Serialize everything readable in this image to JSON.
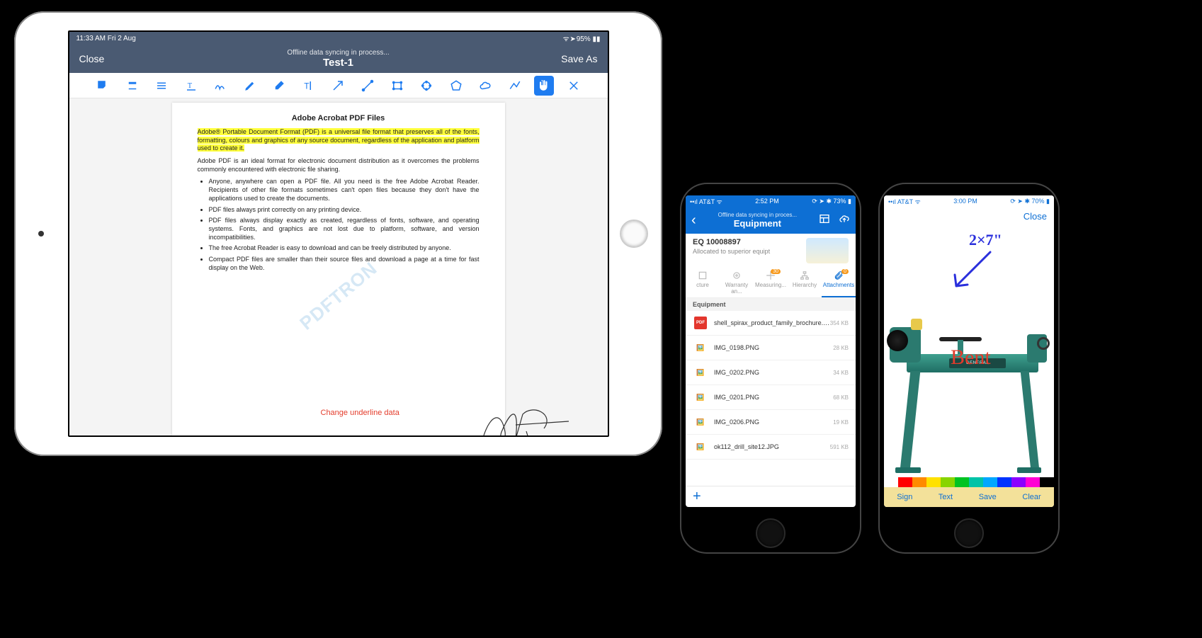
{
  "ipad": {
    "status_left": "11:33 AM  Fri 2 Aug",
    "status_right": "95%",
    "close_label": "Close",
    "saveas_label": "Save As",
    "sync_text": "Offline data syncing in process...",
    "doc_title": "Test-1",
    "toolbar_selected_index": 15,
    "page": {
      "heading": "Adobe Acrobat PDF Files",
      "highlight_para": "Adobe® Portable Document Format (PDF) is a universal file format that preserves all of the fonts, formatting, colours and graphics of any source document, regardless of the application and platform used to create it.",
      "intro_para": "Adobe PDF is an ideal format for electronic document distribution as it overcomes the problems commonly encountered with electronic file sharing.",
      "bullets": [
        "Anyone, anywhere can open a PDF file. All you need is the free Adobe Acrobat Reader. Recipients of other file formats sometimes can't open files because they don't have the applications used to create the documents.",
        "PDF files always print correctly on any printing device.",
        "PDF files always display exactly as created, regardless of fonts, software, and operating systems. Fonts, and graphics are not lost due to platform, software, and version incompatibilities.",
        "The free Acrobat Reader is easy to download and can be freely distributed by anyone.",
        "Compact PDF files are smaller than their source files and download a page at a time for fast display on the Web."
      ],
      "watermark": "PDFTRON",
      "red_annotation": "Change underline data"
    }
  },
  "iphone1": {
    "carrier": "AT&T",
    "time": "2:52 PM",
    "batt": "73%",
    "sync_text": "Offline data syncing in proces...",
    "screen_title": "Equipment",
    "eq": {
      "id": "EQ 10008897",
      "alloc": "Allocated to superior equipt"
    },
    "tabs": [
      {
        "label": "cture",
        "badge": ""
      },
      {
        "label": "Warranty an...",
        "badge": ""
      },
      {
        "label": "Measuring...",
        "badge": "30"
      },
      {
        "label": "Hierarchy",
        "badge": ""
      },
      {
        "label": "Attachments",
        "badge": "0",
        "selected": true
      }
    ],
    "section_label": "Equipment",
    "files": [
      {
        "type": "pdf",
        "name": "shell_spirax_product_family_brochure.PDF",
        "size": "354 KB"
      },
      {
        "type": "img",
        "name": "IMG_0198.PNG",
        "size": "28 KB"
      },
      {
        "type": "img",
        "name": "IMG_0202.PNG",
        "size": "34 KB"
      },
      {
        "type": "img",
        "name": "IMG_0201.PNG",
        "size": "68 KB"
      },
      {
        "type": "img",
        "name": "IMG_0206.PNG",
        "size": "19 KB"
      },
      {
        "type": "img",
        "name": "ok112_drill_site12.JPG",
        "size": "591 KB"
      }
    ]
  },
  "iphone2": {
    "carrier": "AT&T",
    "time": "3:00 PM",
    "batt": "70%",
    "close_label": "Close",
    "annotations": {
      "blue_measure": "2×7\"",
      "red_label": "Bent",
      "machine_badge": "GENERAL"
    },
    "palette": [
      "#ffffff",
      "#ff0000",
      "#ff8a00",
      "#ffe100",
      "#88d400",
      "#00c322",
      "#00c3a7",
      "#00a7ff",
      "#0033ff",
      "#8a00ff",
      "#ff00d4",
      "#000000"
    ],
    "selected_color_index": 0,
    "actions": {
      "sign": "Sign",
      "text": "Text",
      "save": "Save",
      "clear": "Clear"
    }
  }
}
